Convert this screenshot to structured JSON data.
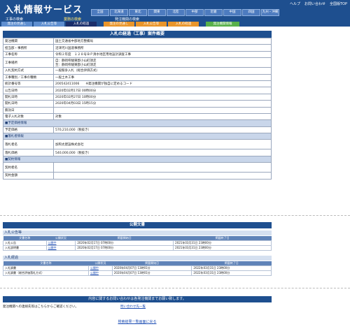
{
  "header": {
    "logo": "入札情報サービス",
    "top_links": [
      "ヘルプ",
      "お問い合わせ",
      "全国版TOP"
    ],
    "regions": [
      "全国",
      "北海道",
      "東北",
      "関東",
      "北陸",
      "中部",
      "近畿",
      "中国",
      "四国",
      "九州・沖縄"
    ],
    "search_construction": "工事の検索",
    "search_business": "業務の検索",
    "search_ordering": "発注機関の検索"
  },
  "tabs": [
    {
      "label": "発注の見通し"
    },
    {
      "label": "入札公告等"
    },
    {
      "label": "入札の経過"
    },
    {
      "label": "発注の見通し"
    },
    {
      "label": "入札公告等"
    },
    {
      "label": "入札の経過"
    },
    {
      "label": "発注機関情報"
    }
  ],
  "summary": {
    "title": "入札の経過（工事）案件概要",
    "rows": [
      {
        "k": "発注機関",
        "v": "国土交通省中部地方整備局"
      },
      {
        "k": "担当部・事務所",
        "v": "沼津河川国道事務所"
      },
      {
        "k": "工事名称",
        "v": "令和２年度　１２８号ＢＰ清水地区用地設計調査工事"
      },
      {
        "k": "工事場所",
        "v": "自：静岡県駿東郡小山町須走\n至：静岡県駿東郡小山町須走"
      },
      {
        "k": "入札契約方式",
        "v": "一般競争入札（総合評価方式）"
      },
      {
        "k": "工事種別／工事の種類",
        "v": "一般土木工事"
      },
      {
        "k": "統計番号等",
        "v": "200542411006　　※発注機関が独自に定めるコード"
      },
      {
        "k": "公告日時",
        "v": "2020年02月17日 00時00分"
      },
      {
        "k": "開札日時",
        "v": "2020年02月27日 10時00分"
      },
      {
        "k": "開札日時",
        "v": "2020年04月03日 15時15分"
      },
      {
        "k": "無効日",
        "v": ""
      },
      {
        "k": "電子入札対象",
        "v": "対象"
      }
    ],
    "group_estimate": "■予定価格情報",
    "estimate_label": "予定価格",
    "estimate_value": "570,210,000（税抜き）",
    "group_winner": "■落札者情報",
    "winner_name_label": "落札者名",
    "winner_name": "加和太建設株式会社",
    "winner_price_label": "落札価格",
    "winner_price": "540,000,000（税抜き）",
    "group_other": "■契約情報",
    "contract_name_label": "契約者名",
    "contract_name": "",
    "contract_amount_label": "契約金額",
    "contract_amount": ""
  },
  "public_docs": {
    "title": "公開文書",
    "sec1": "入札公告等",
    "sec2": "入札経過",
    "cols": [
      "文書名称",
      "公開状況",
      "掲載開始日",
      "掲載終了日"
    ],
    "rows1": [
      [
        "入札公告",
        "公開中",
        "2020年02月17日 07時00分",
        "2021年03月31日 23時00分"
      ],
      [
        "入札説明書",
        "公開中",
        "2020年02月17日 07時00分",
        "2021年03月31日 23時00分"
      ]
    ],
    "rows2": [
      [
        "入札調書",
        "公開中",
        "2020年04月07日 13時01分",
        "2022年03月31日 23時00分"
      ],
      [
        "入札調書（総合評価落札方式）",
        "公開中",
        "2020年04月07日 13時01分",
        "2022年03月31日 23時00分"
      ]
    ]
  },
  "inquiry": {
    "banner": "内容に関するお問い合わせは各発注機関までお願い致します。",
    "text": "発注機関への連絡先等はこちらからご確認ください。",
    "link": "問い合わせ先一覧"
  },
  "footer": {
    "back_link": "検索結果一覧画面に戻る"
  }
}
